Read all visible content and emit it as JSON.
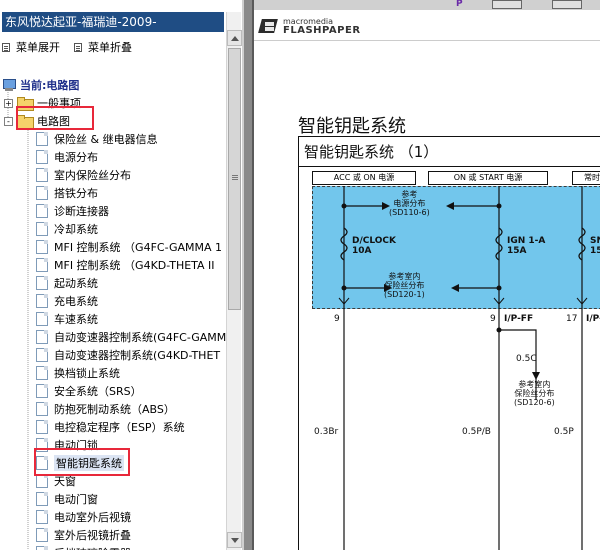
{
  "sidebar": {
    "title": "东风悦达起亚-福瑞迪-2009-",
    "expand_all": "菜单展开",
    "collapse_all": "菜单折叠",
    "current_label": "当前:电路图",
    "folders": [
      {
        "label": "一般事项",
        "expander": "+"
      },
      {
        "label": "电路图",
        "expander": "-"
      }
    ],
    "items": [
      "保险丝 & 继电器信息",
      "电源分布",
      "室内保险丝分布",
      "搭铁分布",
      "诊断连接器",
      "冷却系统",
      "MFI 控制系统 （G4FC-GAMMA 1",
      "MFI 控制系统 （G4KD-THETA II",
      "起动系统",
      "充电系统",
      "车速系统",
      "自动变速器控制系统(G4FC-GAMM",
      "自动变速器控制系统(G4KD-THET",
      "换档锁止系统",
      "安全系统（SRS）",
      "防抱死制动系统（ABS）",
      "电控稳定程序（ESP）系统",
      "电动门锁",
      "智能钥匙系统",
      "天窗",
      "电动门窗",
      "电动室外后视镜",
      "室外后视镜折叠",
      "后挡玻璃除霜器"
    ],
    "selected_index": 18
  },
  "viewer": {
    "logo_small": "macromedia",
    "logo_big": "FLASHPAPER",
    "toolbar_mark": "P"
  },
  "document": {
    "title": "智能钥匙系统",
    "diagram_title": "智能钥匙系统 （1）",
    "sources": [
      "ACC 或 ON 电源",
      "ON 或 START 电源",
      "常时"
    ],
    "refs": [
      {
        "line1": "参考",
        "line2": "电源分布",
        "line3": "(SD110-6)"
      },
      {
        "line1": "参考室内",
        "line2": "保险丝分布",
        "line3": "(SD120-1)"
      },
      {
        "line1": "参考室内",
        "line2": "保险丝分布",
        "line3": "(SD120-6)"
      }
    ],
    "fuses": [
      {
        "name": "D/CLOCK",
        "rating": "10A"
      },
      {
        "name": "IGN  1-A",
        "rating": "15A"
      },
      {
        "name": "SN",
        "rating": "15"
      }
    ],
    "pins": [
      "9",
      "9",
      "17"
    ],
    "connectors": [
      "I/P-FF",
      "I/P-"
    ],
    "wires": [
      "0.5C",
      "0.3Br",
      "0.5P/B",
      "0.5P"
    ],
    "colors": {
      "blue_region": "#72c6ec",
      "highlight_red": "#e8283a",
      "title_bar": "#1f4d84"
    }
  }
}
